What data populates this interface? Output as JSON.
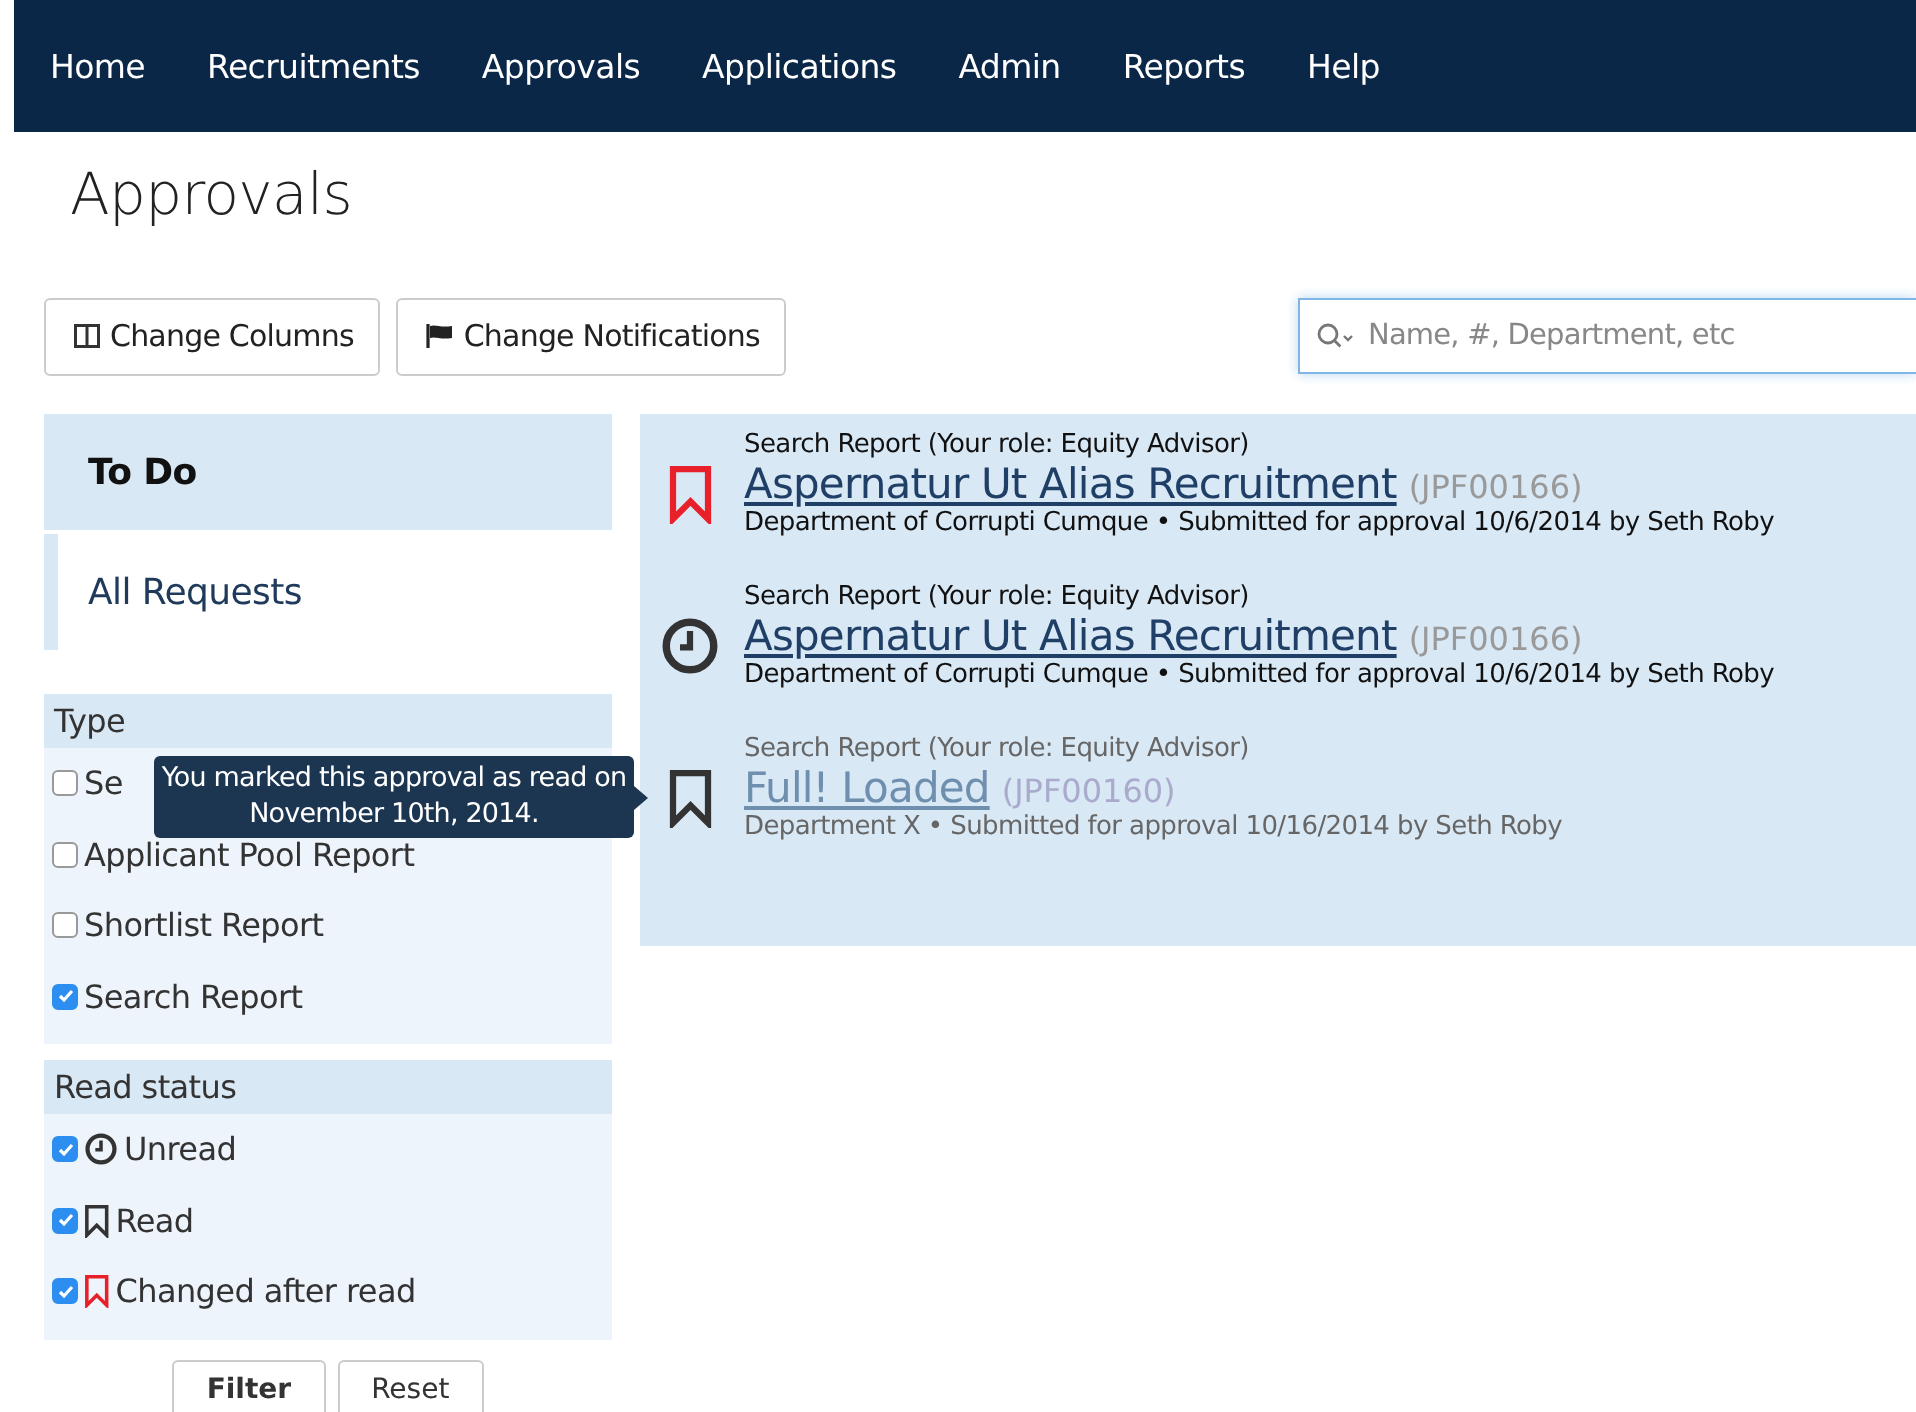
{
  "nav": [
    {
      "label": "Home"
    },
    {
      "label": "Recruitments"
    },
    {
      "label": "Approvals"
    },
    {
      "label": "Applications"
    },
    {
      "label": "Admin"
    },
    {
      "label": "Reports"
    },
    {
      "label": "Help"
    }
  ],
  "page_title": "Approvals",
  "toolbar": {
    "buttons": [
      {
        "label": "Change Columns"
      },
      {
        "label": "Change Notifications"
      }
    ],
    "search": {
      "placeholder": "Name, #, Department, etc"
    }
  },
  "sidebar": {
    "views": [
      {
        "label": "To Do",
        "selected": true
      },
      {
        "label": "All Requests",
        "selected": false
      }
    ],
    "filters": [
      {
        "title": "Type",
        "options": [
          {
            "label": "Se",
            "checked": false
          },
          {
            "label": "Applicant Pool Report",
            "checked": false
          },
          {
            "label": "Shortlist Report",
            "checked": false
          },
          {
            "label": "Search Report",
            "checked": true
          }
        ]
      },
      {
        "title": "Read status",
        "options": [
          {
            "label": "Unread",
            "checked": true,
            "kind": "unread"
          },
          {
            "label": "Read",
            "checked": true,
            "kind": "read"
          },
          {
            "label": "Changed after read",
            "checked": true,
            "kind": "changed"
          }
        ]
      }
    ],
    "buttons": [
      {
        "label": "Filter",
        "primary": true
      },
      {
        "label": "Reset",
        "primary": false
      }
    ]
  },
  "approvals": [
    {
      "kind": "changed",
      "type": "Search Report (Your role: Equity Advisor)",
      "title": "Aspernatur Ut Alias Recruitment",
      "code": "(JPF00166)",
      "details": "Department of Corrupti Cumque • Submitted for approval 10/6/2014 by Seth Roby"
    },
    {
      "kind": "unread",
      "type": "Search Report (Your role: Equity Advisor)",
      "title": "Aspernatur Ut Alias Recruitment",
      "code": "(JPF00166)",
      "details": "Department of Corrupti Cumque • Submitted for approval 10/6/2014 by Seth Roby"
    },
    {
      "kind": "read",
      "type": "Search Report (Your role: Equity Advisor)",
      "title": "Full! Loaded",
      "code": "(JPF00160)",
      "details": "Department X • Submitted for approval 10/16/2014 by Seth Roby",
      "tooltip": "You marked this approval as read on November 10th, 2014."
    }
  ]
}
